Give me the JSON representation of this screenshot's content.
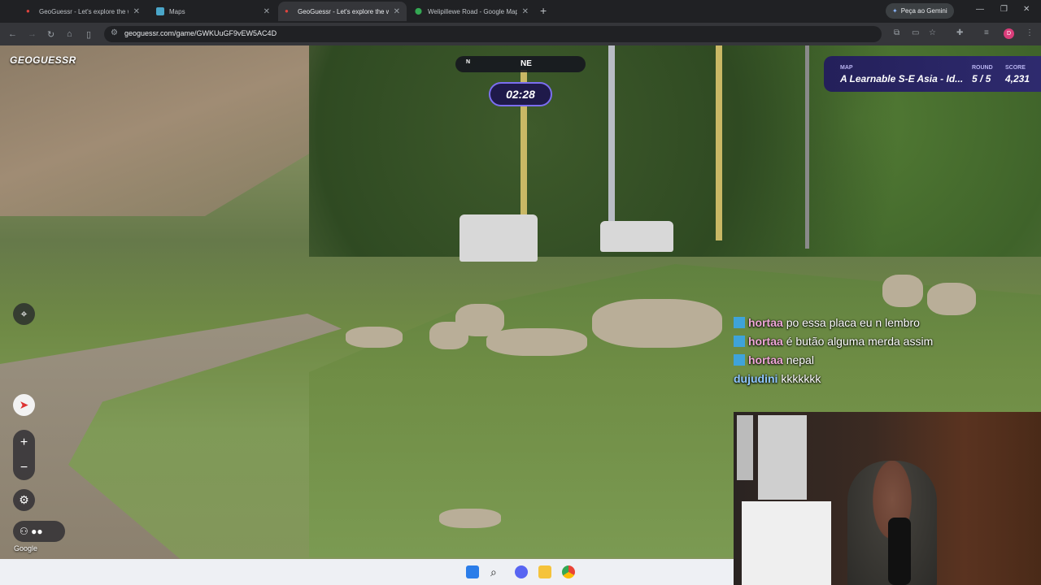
{
  "browser": {
    "tabs": [
      {
        "title": "GeoGuessr - Let's explore the w",
        "icon": "geoguessr-favicon"
      },
      {
        "title": "Maps",
        "icon": "maps-favicon"
      },
      {
        "title": "GeoGuessr - Let's explore the w",
        "icon": "geoguessr-favicon",
        "active": true
      },
      {
        "title": "Welipillewe Road - Google Map",
        "icon": "google-maps-favicon"
      }
    ],
    "gemini_label": "Peça ao Gemini",
    "url": "geoguessr.com/game/GWKUuGF9vEW5AC4D",
    "profile_initial": "D"
  },
  "game": {
    "logo": "GEOGUESSR",
    "compass": {
      "n": "N",
      "ne": "NE"
    },
    "timer": "02:28",
    "map_label": "MAP",
    "map_value": "A Learnable S-E Asia - Id...",
    "round_label": "ROUND",
    "round_value": "5 / 5",
    "score_label": "SCORE",
    "score_value": "4,231",
    "zoom_in": "+",
    "zoom_out": "−",
    "attribution": "Google"
  },
  "chat": [
    {
      "user": "hortaa",
      "text": "po essa placa eu n lembro",
      "badge": true
    },
    {
      "user": "hortaa",
      "text": "é butão alguma merda assim",
      "badge": true
    },
    {
      "user": "hortaa",
      "text": "nepal",
      "badge": true
    },
    {
      "user": "dujudini",
      "text": "kkkkkkk",
      "badge": false
    }
  ],
  "colors": {
    "accent": "#7b6ef0",
    "status_bg": "#24205a",
    "chat_user": "#f0a8d8"
  }
}
